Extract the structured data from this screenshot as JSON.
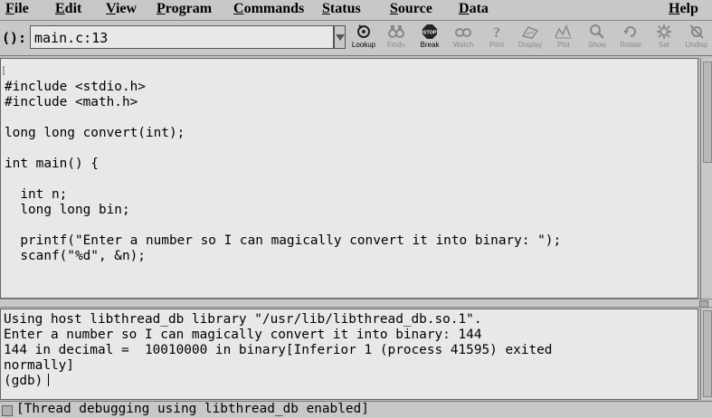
{
  "menus": {
    "file": {
      "ul": "F",
      "rest": "ile"
    },
    "edit": {
      "ul": "E",
      "rest": "dit"
    },
    "view": {
      "ul": "V",
      "rest": "iew"
    },
    "program": {
      "ul": "P",
      "rest": "rogram"
    },
    "commands": {
      "ul": "C",
      "rest": "ommands"
    },
    "status": {
      "ul": "S",
      "rest": "tatus"
    },
    "source": {
      "ul": "S",
      "rest": "ource"
    },
    "data": {
      "ul": "D",
      "rest": "ata"
    },
    "help": {
      "ul": "H",
      "rest": "elp"
    }
  },
  "toolbar": {
    "arg_label": "():",
    "arg_value": "main.c:13",
    "buttons": {
      "lookup": "Lookup",
      "find": "Find»",
      "break": "Break",
      "watch": "Watch",
      "print": "Print",
      "display": "Display",
      "plot": "Plot",
      "show": "Show",
      "rotate": "Rotate",
      "set": "Set",
      "undisp": "Undisp"
    }
  },
  "source": {
    "code": "#include <stdio.h>\n#include <math.h>\n\nlong long convert(int);\n\nint main() {\n\n  int n;\n  long long bin;\n\n  printf(\"Enter a number so I can magically convert it into binary: \");\n  scanf(\"%d\", &n);"
  },
  "console": {
    "text": "Using host libthread_db library \"/usr/lib/libthread_db.so.1\".\nEnter a number so I can magically convert it into binary: 144\n144 in decimal =  10010000 in binary[Inferior 1 (process 41595) exited\nnormally]\n(gdb)"
  },
  "status": {
    "text": "[Thread debugging using libthread_db enabled]"
  }
}
